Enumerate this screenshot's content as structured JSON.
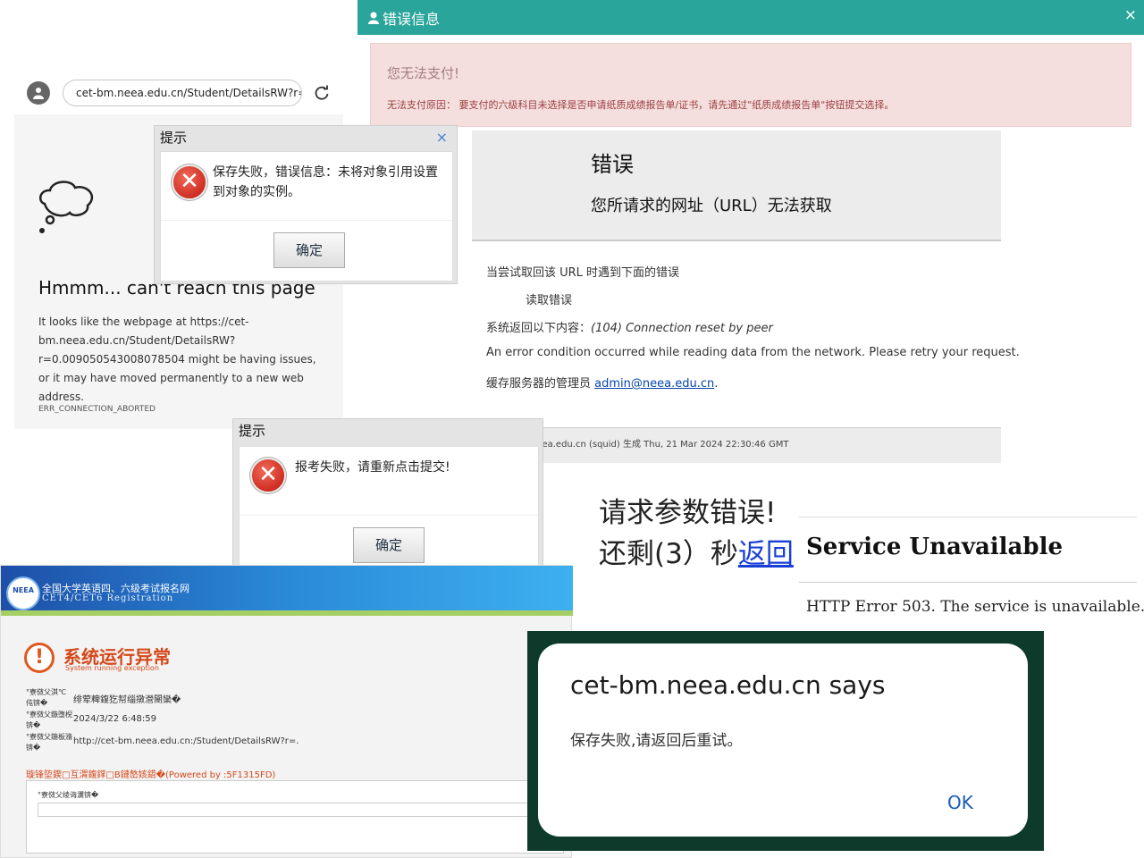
{
  "edge": {
    "url": "cet-bm.neea.edu.cn/Student/DetailsRW?r=0",
    "title": "Hmmm... can't reach this page",
    "body": "It looks like the webpage at https://cet-bm.neea.edu.cn/Student/DetailsRW?r=0.009050543008078504 might be having issues, or it may have moved permanently to a new web address.",
    "code": "ERR_CONNECTION_ABORTED"
  },
  "dialog1": {
    "title": "提示",
    "close": "×",
    "message": "保存失败，错误信息：未将对象引用设置到对象的实例。",
    "ok": "确定"
  },
  "dialog2": {
    "title": "提示",
    "message": "报考失败，请重新点击提交!",
    "ok": "确定"
  },
  "error_info": {
    "title": "错误信息",
    "close": "×",
    "heading": "您无法支付!",
    "reason": "无法支付原因：   要支付的六级科目未选择是否申请纸质成绩报告单/证书，请先通过\"纸质成绩报告单\"按钮提交选择。"
  },
  "squid": {
    "h1": "错误",
    "h2": "您所请求的网址（URL）无法获取",
    "line1": "当尝试取回该 URL 时遇到下面的错误",
    "line2": "读取错误",
    "line3_prefix": "系统返回以下内容：",
    "line3_detail": "(104) Connection reset by peer",
    "line4": "An error condition occurred while reading data from the network. Please retry your request.",
    "line5_prefix": "缓存服务器的管理员 ",
    "admin_email": "admin@neea.edu.cn",
    "line5_suffix": ".",
    "footer": "已由 www.neea.edu.cn (squid) 生成 Thu, 21 Mar 2024 22:30:46 GMT"
  },
  "request_error": {
    "line1": "请求参数错误!",
    "line2_prefix": "还剩(3）秒",
    "back_link": "返回"
  },
  "service": {
    "heading": "Service Unavailable",
    "message": "HTTP Error 503. The service is unavailable."
  },
  "cet": {
    "banner_title": "全国大学英语四、六级考试报名网",
    "banner_sub": "CET4/CET6  Registration",
    "logo_text": "NEEA",
    "exception_title": "系统运行异常",
    "exception_sub": "System running exception",
    "label1": "°寮傚父淇℃伅锛�",
    "value1": "绯荤粺鍑犵幇缁撴瀯閿欒�",
    "label2": "°寮傚父鏃堕棿锛�",
    "value2": "2024/3/22 6:48:59",
    "label3": "°寮傚父鍦板潃锛�",
    "value3": "http://cet-bm.neea.edu.cn:/Student/DetailsRW?r=.",
    "red_line": "璇锋埅鍥□互渭鍑鐣□B鏈嶅姟鍣�(Powered by :5F1315FD)",
    "box_label": "°寮傚父绫诲瀷锛�"
  },
  "android": {
    "title": "cet-bm.neea.edu.cn says",
    "message": "保存失败,请返回后重试。",
    "ok": "OK"
  }
}
